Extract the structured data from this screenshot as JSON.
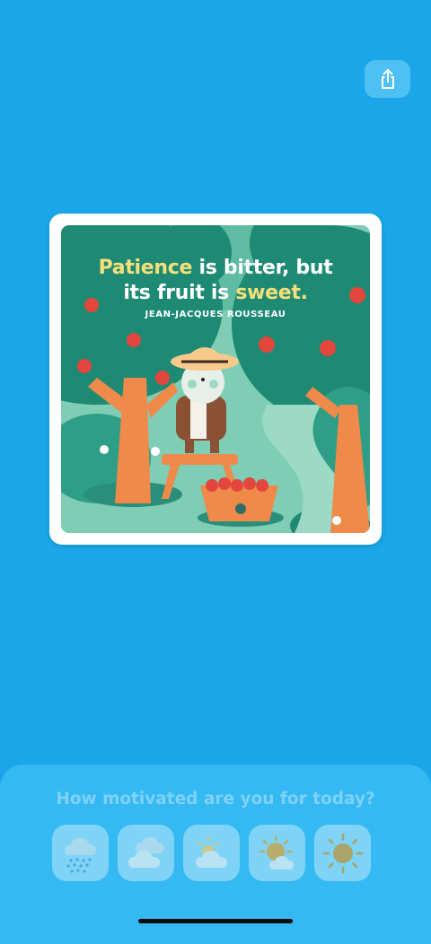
{
  "share": {
    "icon": "share-icon"
  },
  "quote_card": {
    "quote_part1": "Patience",
    "quote_part2": " is bitter, but",
    "quote_part3": "its fruit is ",
    "quote_part4": "sweet.",
    "author": "JEAN-JACQUES ROUSSEAU",
    "highlight_color": "#f5e07a"
  },
  "mood_sheet": {
    "title": "How motivated are you for today?",
    "options": [
      {
        "icon": "rain-cloud-icon"
      },
      {
        "icon": "cloudy-icon"
      },
      {
        "icon": "partly-cloudy-icon"
      },
      {
        "icon": "mostly-sunny-icon"
      },
      {
        "icon": "sunny-icon"
      }
    ]
  },
  "colors": {
    "background": "#1aa6e8",
    "sheet": "#35b9f3",
    "tile": "#7ed3f7",
    "title_text": "#7fd2f6"
  }
}
